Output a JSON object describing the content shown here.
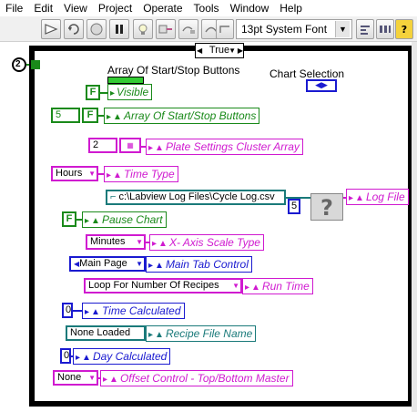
{
  "menu": [
    "File",
    "Edit",
    "View",
    "Project",
    "Operate",
    "Tools",
    "Window",
    "Help"
  ],
  "toolbar": {
    "font": "13pt System Font",
    "help_icon": "?"
  },
  "case_selector": "True",
  "iteration_label": "2",
  "labels": {
    "array_start_stop": "Array Of Start/Stop Buttons",
    "chart_selection": "Chart Selection"
  },
  "constants": {
    "visible_bool": "F",
    "array_index": "5",
    "array_bool": "F",
    "plate_index": "2",
    "time_type": "Hours",
    "log_path": "c:\\Labview Log Files\\Cycle Log.csv",
    "log_num": "5",
    "pause_bool": "F",
    "x_axis": "Minutes",
    "main_tab": "Main Page",
    "loop_recipes": "Loop For Number Of Recipes",
    "time_calc": "0",
    "recipe_file": "None Loaded",
    "day_calc": "0",
    "offset": "None"
  },
  "properties": {
    "visible": "Visible",
    "array_start_stop": "Array Of Start/Stop Buttons",
    "plate_settings": "Plate Settings Cluster Array",
    "time_type": "Time Type",
    "log_file": "Log File",
    "pause_chart": "Pause Chart",
    "x_axis": "X- Axis Scale Type",
    "main_tab": "Main Tab Control",
    "run_time": "Run Time",
    "time_calculated": "Time Calculated",
    "recipe_file": "Recipe File Name",
    "day_calculated": "Day Calculated",
    "offset": "Offset Control - Top/Bottom Master"
  }
}
